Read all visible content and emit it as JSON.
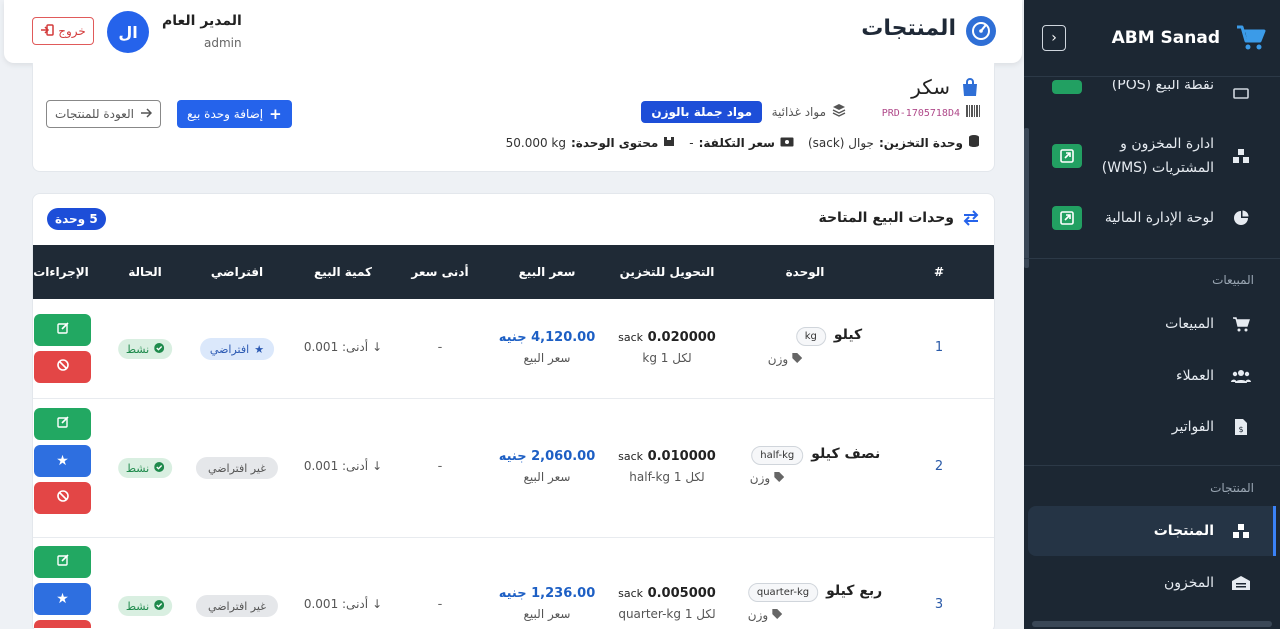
{
  "sidebar": {
    "brand": "ABM Sanad",
    "items": [
      {
        "label": "نقطة البيع (POS)"
      },
      {
        "label": "ادارة المخزون و المشتريات (WMS)",
        "line1": "ادارة المخزون و",
        "line2": "المشتريات (WMS)"
      },
      {
        "label": "لوحة الإدارة المالية"
      },
      {
        "label": "المبيعات"
      },
      {
        "label": "العملاء"
      },
      {
        "label": "الفواتير"
      },
      {
        "label": "المنتجات"
      },
      {
        "label": "المخزون"
      }
    ],
    "sections": {
      "sales": "المبيعات",
      "products": "المنتجات"
    },
    "active": "المنتجات"
  },
  "header": {
    "title": "المنتجات",
    "user_name": "المدير العام",
    "user_role": "admin",
    "avatar_initials": "ال",
    "logout_label": "خروج"
  },
  "product": {
    "name": "سكر",
    "sku": "PRD-1705718D4",
    "category": "مواد غذائية",
    "type_badge": "مواد جملة بالوزن",
    "storage_label": "وحدة التخزين:",
    "storage_value": "جوال (sack)",
    "cost_label": "سعر التكلفة:",
    "cost_value": "-",
    "content_label": "محتوى الوحدة:",
    "content_value": "50.000 kg",
    "add_button": "إضافة وحدة بيع",
    "back_button": "العودة للمنتجات"
  },
  "units": {
    "title": "وحدات البيع المتاحة",
    "count_badge": "5 وحدة",
    "columns": [
      "#",
      "الوحدة",
      "التحويل للتخزين",
      "سعر البيع",
      "أدنى سعر",
      "كمية البيع",
      "افتراضي",
      "الحالة",
      "الإجراءات"
    ],
    "rows": [
      {
        "num": "1",
        "name": "كيلو",
        "code": "kg",
        "type": "وزن",
        "conv": "0.020000",
        "conv_unit": "sack",
        "per": "لكل 1 kg",
        "price": "4,120.00 جنيه",
        "price_sub": "سعر البيع",
        "min_price": "-",
        "min_qty": "أدنى: 0.001",
        "default": "افتراضي",
        "status": "نشط"
      },
      {
        "num": "2",
        "name": "نصف كيلو",
        "code": "half-kg",
        "type": "وزن",
        "conv": "0.010000",
        "conv_unit": "sack",
        "per": "لكل 1 half-kg",
        "price": "2,060.00 جنيه",
        "price_sub": "سعر البيع",
        "min_price": "-",
        "min_qty": "أدنى: 0.001",
        "default": "غير افتراضي",
        "status": "نشط"
      },
      {
        "num": "3",
        "name": "ربع كيلو",
        "code": "quarter-kg",
        "type": "وزن",
        "conv": "0.005000",
        "conv_unit": "sack",
        "per": "لكل 1 quarter-kg",
        "price": "1,236.00 جنيه",
        "price_sub": "سعر البيع",
        "min_price": "-",
        "min_qty": "أدنى: 0.001",
        "default": "غير افتراضي",
        "status": "نشط"
      }
    ]
  },
  "colors": {
    "sidebar_bg": "#1c2733",
    "primary": "#2563eb",
    "success": "#22a862",
    "danger": "#e34646"
  },
  "icons": {
    "cart": "cart-icon",
    "products": "boxes-icon",
    "title": "gauge-icon"
  }
}
